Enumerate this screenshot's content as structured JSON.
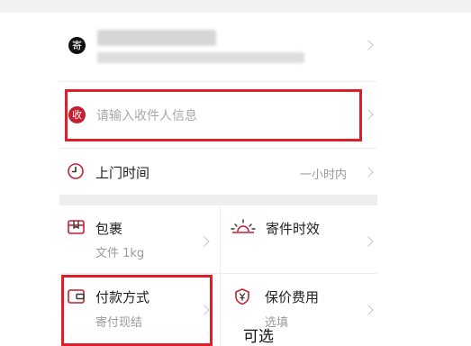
{
  "sender": {
    "badge": "寄"
  },
  "receiver": {
    "badge": "收",
    "placeholder": "请输入收件人信息"
  },
  "pickup": {
    "label": "上门时间",
    "value": "一小时内"
  },
  "package": {
    "label": "包裹",
    "sub": "文件 1kg"
  },
  "timing": {
    "label": "寄件时效"
  },
  "payment": {
    "label": "付款方式",
    "sub": "寄付现结"
  },
  "insurance": {
    "label": "保价费用",
    "sub": "选填"
  },
  "annotation": {
    "note": "可选"
  },
  "colors": {
    "highlight": "#e21d2a",
    "receiver_badge": "#c41f2e",
    "icon_red": "#c41f2e",
    "icon_dark": "#333333"
  }
}
